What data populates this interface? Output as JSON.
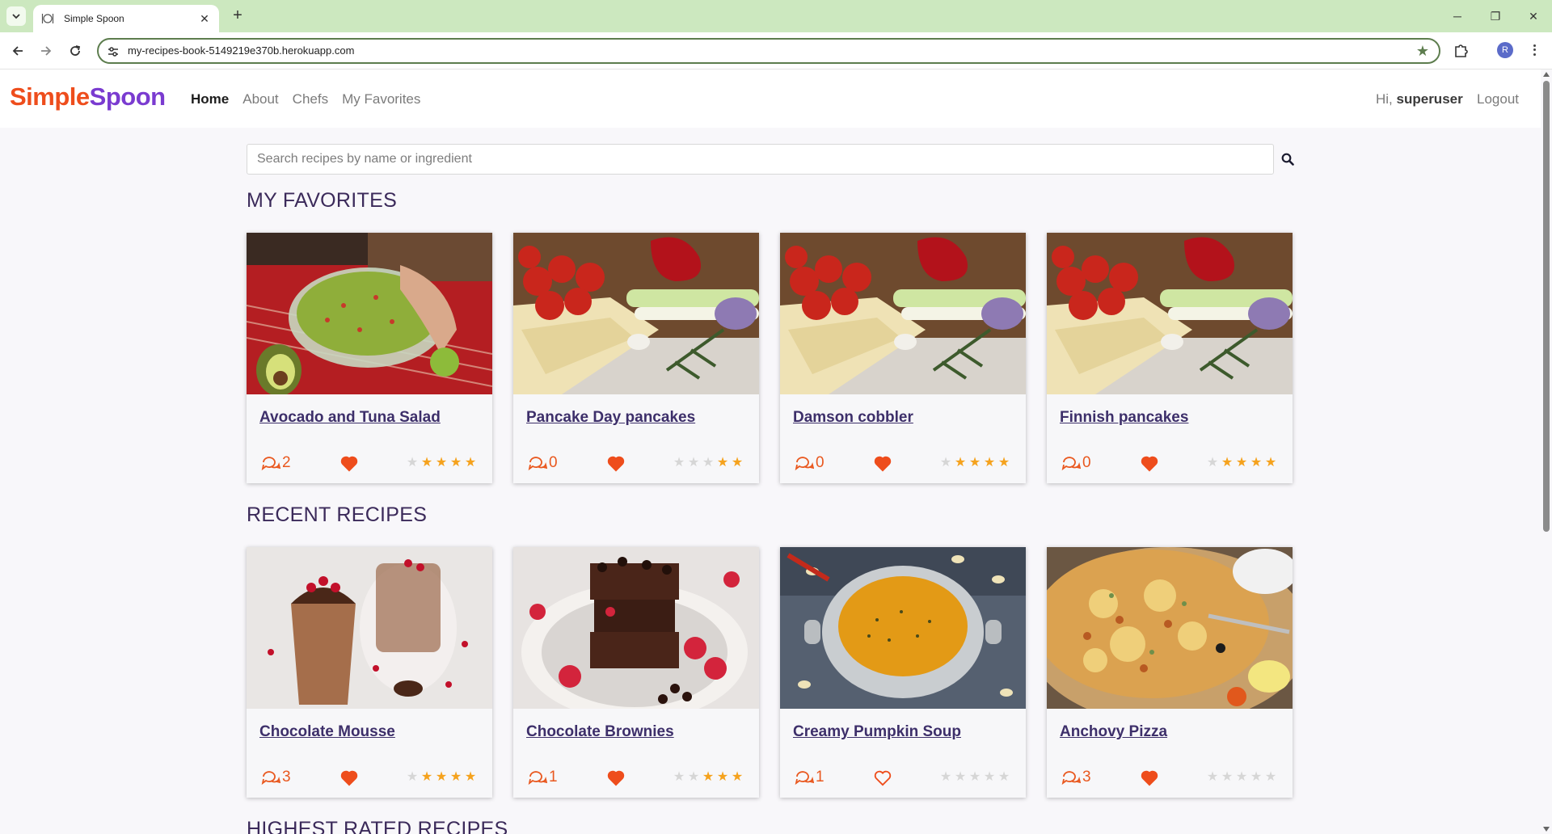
{
  "browser": {
    "tab_title": "Simple Spoon",
    "url": "my-recipes-book-5149219e370b.herokuapp.com",
    "profile_initial": "R"
  },
  "site": {
    "logo_part1": "Simple",
    "logo_part2": "Spoon",
    "nav": [
      "Home",
      "About",
      "Chefs",
      "My Favorites"
    ],
    "active_nav": "Home",
    "greeting_prefix": "Hi,",
    "username": "superuser",
    "logout_label": "Logout",
    "brand_orange": "#ee4d1c",
    "brand_purple": "#7a3bd0",
    "accent_gold": "#f5a21d"
  },
  "search": {
    "placeholder": "Search recipes by name or ingredient"
  },
  "sections": [
    {
      "title": "MY FAVORITES",
      "cards": [
        {
          "title": "Avocado and Tuna Salad",
          "comments": "2",
          "favorited": true,
          "rating": 4,
          "image": "guacamole"
        },
        {
          "title": "Pancake Day pancakes",
          "comments": "0",
          "favorited": true,
          "rating": 2,
          "image": "vegetables"
        },
        {
          "title": "Damson cobbler",
          "comments": "0",
          "favorited": true,
          "rating": 4,
          "image": "vegetables"
        },
        {
          "title": "Finnish pancakes",
          "comments": "0",
          "favorited": true,
          "rating": 4,
          "image": "vegetables"
        }
      ]
    },
    {
      "title": "RECENT RECIPES",
      "cards": [
        {
          "title": "Chocolate Mousse",
          "comments": "3",
          "favorited": true,
          "rating": 4,
          "image": "mousse"
        },
        {
          "title": "Chocolate Brownies",
          "comments": "1",
          "favorited": true,
          "rating": 3,
          "image": "brownies"
        },
        {
          "title": "Creamy Pumpkin Soup",
          "comments": "1",
          "favorited": false,
          "rating": 0,
          "image": "soup"
        },
        {
          "title": "Anchovy Pizza",
          "comments": "3",
          "favorited": true,
          "rating": 0,
          "image": "pizza"
        }
      ]
    },
    {
      "title": "HIGHEST RATED RECIPES",
      "cards": []
    }
  ]
}
